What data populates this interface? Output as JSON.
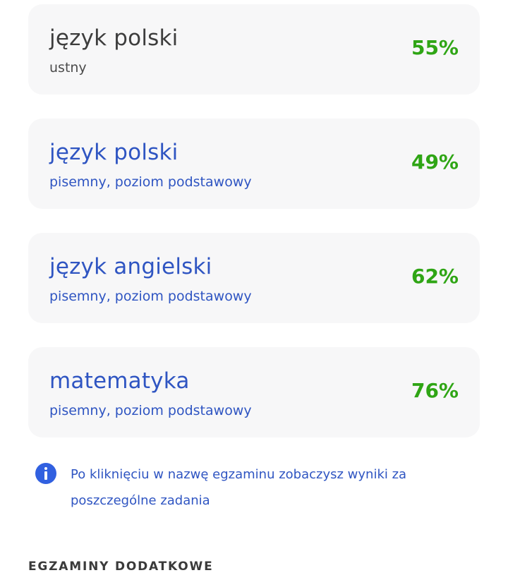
{
  "exams": [
    {
      "name": "język polski",
      "detail": "ustny",
      "score": "55%"
    },
    {
      "name": "język polski",
      "detail": "pisemny, poziom podstawowy",
      "score": "49%"
    },
    {
      "name": "język angielski",
      "detail": "pisemny, poziom podstawowy",
      "score": "62%"
    },
    {
      "name": "matematyka",
      "detail": "pisemny, poziom podstawowy",
      "score": "76%"
    }
  ],
  "info": {
    "icon": "info-icon",
    "text": "Po kliknięciu w nazwę egzaminu zobaczysz wyniki za poszczególne zadania"
  },
  "section": {
    "heading": "EGZAMINY DODATKOWE"
  },
  "colors": {
    "link": "#2f55c2",
    "score": "#2fa515",
    "card_bg": "#f7f7f8",
    "info_icon": "#3160e0"
  }
}
